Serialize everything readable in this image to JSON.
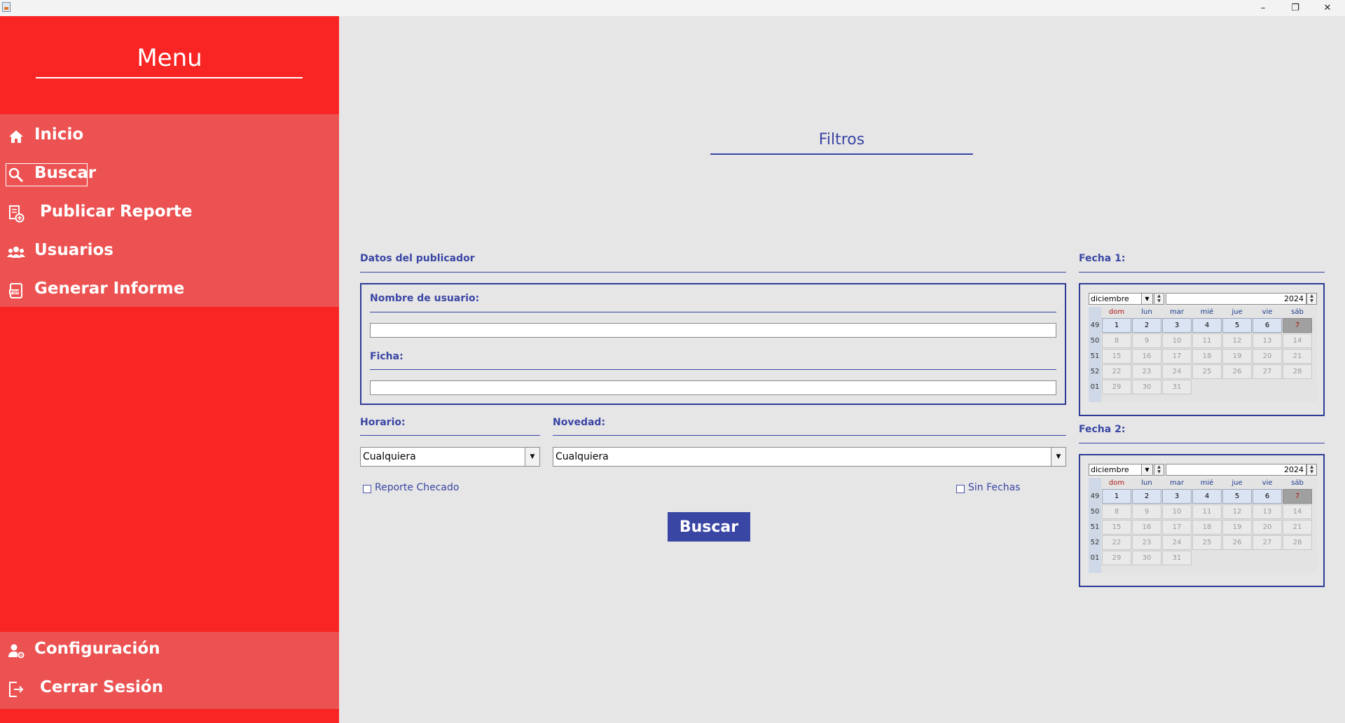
{
  "sidebar": {
    "title": "Menu",
    "items": [
      {
        "label": "Inicio",
        "icon": "home-icon"
      },
      {
        "label": "Buscar",
        "icon": "search-icon"
      },
      {
        "label": "Publicar Reporte",
        "icon": "report-add-icon"
      },
      {
        "label": "Usuarios",
        "icon": "users-icon"
      },
      {
        "label": "Generar Informe",
        "icon": "pdf-icon"
      }
    ],
    "bottom_items": [
      {
        "label": "Configuración",
        "icon": "user-settings-icon"
      },
      {
        "label": "Cerrar Sesión",
        "icon": "logout-icon"
      }
    ],
    "selected_item": "Buscar",
    "colors": {
      "background": "#f92424",
      "nav_band": "#ec5252",
      "text": "#ffffff"
    }
  },
  "main": {
    "title": "Filtros",
    "publisher": {
      "section_label": "Datos del publicador",
      "username_label": "Nombre de usuario:",
      "username_value": "",
      "ficha_label": "Ficha:",
      "ficha_value": ""
    },
    "horario": {
      "label": "Horario:",
      "selected": "Cualquiera"
    },
    "novedad": {
      "label": "Novedad:",
      "selected": "Cualquiera"
    },
    "reporte_checado": {
      "label": "Reporte Checado",
      "checked": false
    },
    "sin_fechas": {
      "label": "Sin Fechas",
      "checked": false
    },
    "search_button": "Buscar",
    "accent_color": "#3a46a4"
  },
  "calendars": [
    {
      "label": "Fecha 1:",
      "month": "diciembre",
      "year": "2024",
      "day_headers": [
        "dom",
        "lun",
        "mar",
        "mié",
        "jue",
        "vie",
        "sáb"
      ],
      "weeks": [
        {
          "num": "49",
          "days": [
            "1",
            "2",
            "3",
            "4",
            "5",
            "6",
            "7"
          ]
        },
        {
          "num": "50",
          "days": [
            "8",
            "9",
            "10",
            "11",
            "12",
            "13",
            "14"
          ]
        },
        {
          "num": "51",
          "days": [
            "15",
            "16",
            "17",
            "18",
            "19",
            "20",
            "21"
          ]
        },
        {
          "num": "52",
          "days": [
            "22",
            "23",
            "24",
            "25",
            "26",
            "27",
            "28"
          ]
        },
        {
          "num": "01",
          "days": [
            "29",
            "30",
            "31"
          ]
        }
      ],
      "selected_day": "7"
    },
    {
      "label": "Fecha 2:",
      "month": "diciembre",
      "year": "2024",
      "day_headers": [
        "dom",
        "lun",
        "mar",
        "mié",
        "jue",
        "vie",
        "sáb"
      ],
      "weeks": [
        {
          "num": "49",
          "days": [
            "1",
            "2",
            "3",
            "4",
            "5",
            "6",
            "7"
          ]
        },
        {
          "num": "50",
          "days": [
            "8",
            "9",
            "10",
            "11",
            "12",
            "13",
            "14"
          ]
        },
        {
          "num": "51",
          "days": [
            "15",
            "16",
            "17",
            "18",
            "19",
            "20",
            "21"
          ]
        },
        {
          "num": "52",
          "days": [
            "22",
            "23",
            "24",
            "25",
            "26",
            "27",
            "28"
          ]
        },
        {
          "num": "01",
          "days": [
            "29",
            "30",
            "31"
          ]
        }
      ],
      "selected_day": "7"
    }
  ],
  "window_controls": {
    "minimize": "–",
    "maximize": "❐",
    "close": "✕"
  }
}
